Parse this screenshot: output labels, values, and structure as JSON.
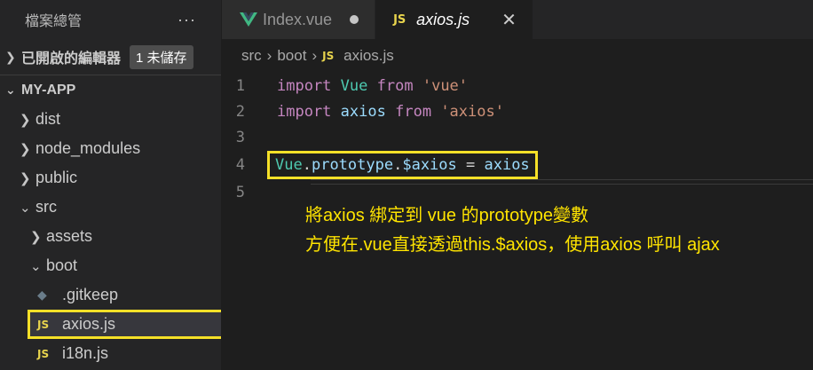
{
  "sidebar": {
    "title": "檔案總管",
    "more": "···",
    "open_editors": {
      "label": "已開啟的編輯器",
      "badge": "1 未儲存"
    },
    "project": "MY-APP",
    "items": [
      {
        "label": "dist",
        "type": "folder",
        "expanded": false
      },
      {
        "label": "node_modules",
        "type": "folder",
        "expanded": false
      },
      {
        "label": "public",
        "type": "folder",
        "expanded": false
      },
      {
        "label": "src",
        "type": "folder",
        "expanded": true
      },
      {
        "label": "assets",
        "type": "folder",
        "expanded": false
      },
      {
        "label": "boot",
        "type": "folder",
        "expanded": true
      },
      {
        "label": ".gitkeep",
        "type": "file"
      },
      {
        "label": "axios.js",
        "type": "file",
        "icon": "JS"
      },
      {
        "label": "i18n.js",
        "type": "file",
        "icon": "JS"
      }
    ]
  },
  "tabs": [
    {
      "label": "Index.vue",
      "icon": "vue-icon",
      "unsaved": true
    },
    {
      "label": "axios.js",
      "icon": "JS",
      "active": true,
      "close": "✕"
    }
  ],
  "breadcrumb": {
    "parts": [
      "src",
      "boot"
    ],
    "file": "axios.js",
    "icon": "JS"
  },
  "code": {
    "line_numbers": [
      "1",
      "2",
      "3",
      "4",
      "5"
    ],
    "l1": {
      "import": "import",
      "name": "Vue",
      "from": "from",
      "module": "'vue'"
    },
    "l2": {
      "import": "import",
      "name": "axios",
      "from": "from",
      "module": "'axios'"
    },
    "l4": {
      "cls": "Vue",
      "dot1": ".",
      "prop": "prototype",
      "dot2": ".",
      "var": "$axios",
      "eq": " = ",
      "value": "axios"
    }
  },
  "annotations": [
    "將axios 綁定到 vue 的prototype變數",
    "方便在.vue直接透過this.$axios，使用axios 呼叫 ajax"
  ],
  "colors": {
    "highlight": "#f5e028",
    "note": "#ffe400",
    "js": "#e8d44d"
  }
}
